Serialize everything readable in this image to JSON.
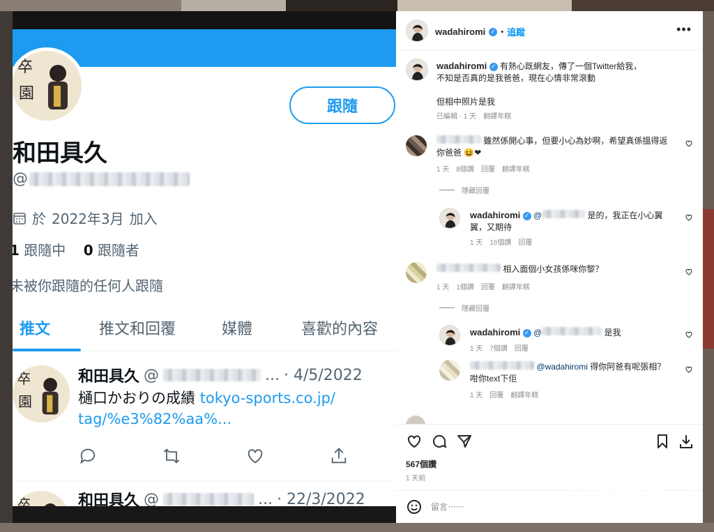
{
  "twitter": {
    "follow_label": "跟隨",
    "name": "和田具久",
    "handle_prefix": "@",
    "joined_prefix": "於",
    "joined_date": "2022年3月",
    "joined_suffix": "加入",
    "following_count": "1",
    "following_label": "跟隨中",
    "followers_count": "0",
    "followers_label": "跟隨者",
    "not_followed_text": "未被你跟隨的任何人跟隨",
    "tabs": [
      {
        "label": "推文"
      },
      {
        "label": "推文和回覆"
      },
      {
        "label": "媒體"
      },
      {
        "label": "喜歡的內容"
      }
    ],
    "tweets": [
      {
        "name": "和田具久",
        "handle_prefix": "@",
        "ellipsis": "...",
        "date": "· 4/5/2022",
        "text": "樋口かおりの成績",
        "link_line1": "tokyo-sports.co.jp/",
        "link_line2": "tag/%e3%82%aa%..."
      },
      {
        "name": "和田具久",
        "handle_prefix": "@",
        "ellipsis": "...",
        "date": "· 22/3/2022"
      }
    ]
  },
  "instagram": {
    "username": "wadahiromi",
    "follow_label": "追蹤",
    "caption": {
      "username": "wadahiromi",
      "line1": "有熱心既網友，傳了一個Twitter給我，",
      "line2": "不知是否真的是我爸爸，現在心情非常滾動",
      "line3": "但相中照片是我",
      "meta": [
        "已編輯 · 1 天",
        "翻譯年糕"
      ]
    },
    "comments": [
      {
        "text_line1": "雖然係開心事，但要小心為妙啊，希望真係搵得返",
        "text_line2": "你爸爸",
        "emoji": "😆❤",
        "meta": [
          "1 天",
          "8個讚",
          "回覆",
          "翻譯年糕"
        ],
        "hide_label": "隱藏回覆"
      },
      {
        "username": "wadahiromi",
        "mention_prefix": "@",
        "text_line1": "是的，我正在小心翼",
        "text_line2": "翼，又期待",
        "meta": [
          "1 天",
          "16個讚",
          "回覆"
        ]
      },
      {
        "text_line1": "相入面個小女孩係咪你黎？",
        "meta": [
          "1 天",
          "1個讚",
          "回覆",
          "翻譯年糕"
        ],
        "hide_label": "隱藏回覆"
      },
      {
        "username": "wadahiromi",
        "mention_prefix": "@",
        "text_line1": "是我",
        "meta": [
          "1 天",
          "7個讚",
          "回覆"
        ]
      },
      {
        "mention": "@wadahiromi",
        "text_line1": "得你阿爸有呢張相？",
        "text_line2": "咁你text下佢",
        "meta": [
          "1 天",
          "回覆",
          "翻譯年糕"
        ]
      }
    ],
    "likes": "567個讚",
    "time_ago": "1 天前",
    "comment_placeholder": "留言⋯⋯",
    "more_label": "•••"
  },
  "watermark": {
    "text": "星島頭條"
  },
  "colors": {
    "twitter_blue": "#1d9bf0",
    "ig_blue": "#0095f6",
    "heart": "#ed4956"
  }
}
